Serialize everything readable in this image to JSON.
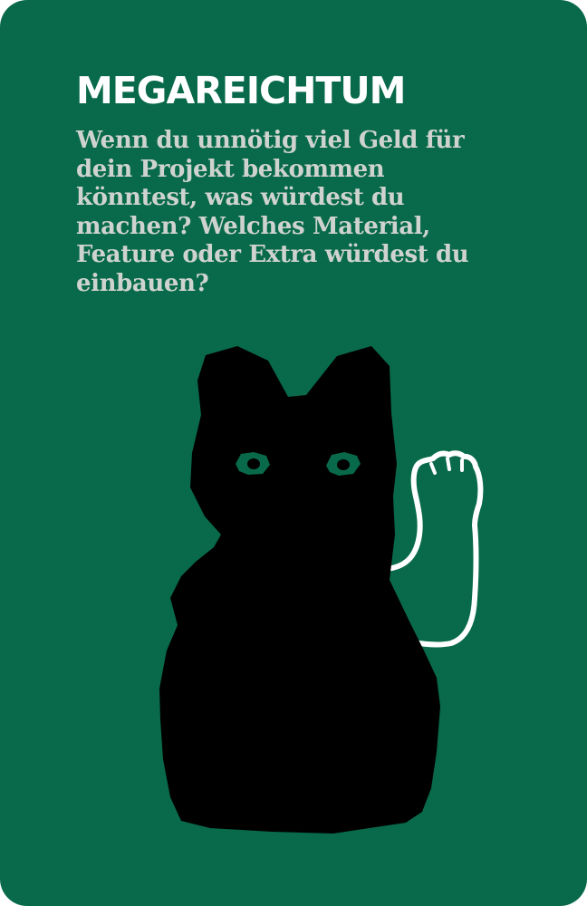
{
  "card": {
    "title": "MEGAREICHTUM",
    "question": "Wenn du unnötig viel Geld für dein Projekt bekommen könntest, was würdest du machen? Welches Material, Feature oder Extra würdest du einbauen?",
    "illustration_icon": "waving-lucky-cat-icon",
    "colors": {
      "background": "#086a4a",
      "title": "#ffffff",
      "question_text": "#cfd3cf",
      "cat": "#000000",
      "cat_eyes": "#086a4a",
      "paw_outline": "#ffffff"
    }
  }
}
